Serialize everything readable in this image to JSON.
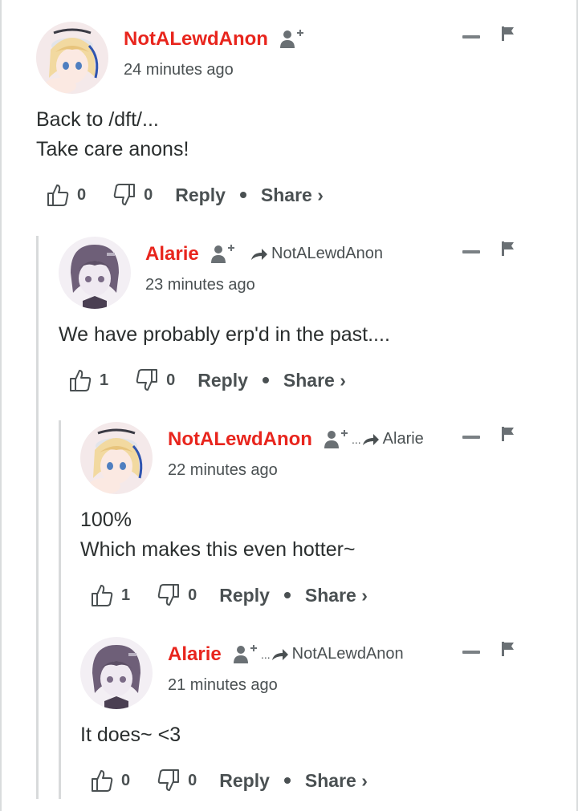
{
  "comments": [
    {
      "author": "NotALewdAnon",
      "avatar": "blonde-maid-avatar",
      "reply_to": "",
      "time": "24 minutes ago",
      "lines": [
        "Back to /dft/...",
        "Take care anons!"
      ],
      "upvotes": "0",
      "downvotes": "0",
      "reply_label": "Reply",
      "share_label": "Share ›"
    },
    {
      "author": "Alarie",
      "avatar": "purple-hair-avatar",
      "reply_to": "NotALewdAnon",
      "time": "23 minutes ago",
      "lines": [
        "We have probably erp'd in the past...."
      ],
      "upvotes": "1",
      "downvotes": "0",
      "reply_label": "Reply",
      "share_label": "Share ›"
    },
    {
      "author": "NotALewdAnon",
      "avatar": "blonde-maid-avatar",
      "reply_to": "Alarie",
      "time": "22 minutes ago",
      "lines": [
        "100%",
        "Which makes this even hotter~"
      ],
      "upvotes": "1",
      "downvotes": "0",
      "reply_label": "Reply",
      "share_label": "Share ›"
    },
    {
      "author": "Alarie",
      "avatar": "purple-hair-avatar",
      "reply_to": "NotALewdAnon",
      "time": "21 minutes ago",
      "lines": [
        "It does~ <3"
      ],
      "upvotes": "0",
      "downvotes": "0",
      "reply_label": "Reply",
      "share_label": "Share ›"
    }
  ],
  "colors": {
    "author": "#e8251d",
    "text": "#2a2e2e",
    "meta": "#4a5052",
    "thread_line": "#d8dadb"
  },
  "icons": [
    "follow-user-icon",
    "reply-arrow-icon",
    "collapse-icon",
    "flag-icon",
    "thumbs-up-icon",
    "thumbs-down-icon"
  ]
}
